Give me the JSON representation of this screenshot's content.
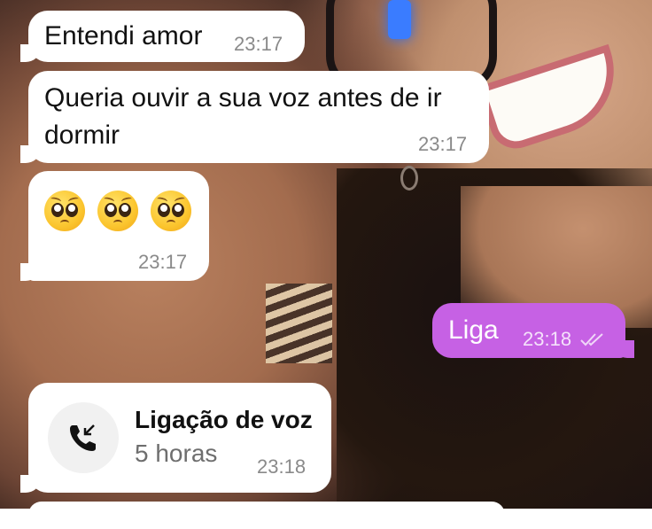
{
  "messages": [
    {
      "direction": "incoming",
      "text": "Entendi amor",
      "time": "23:17"
    },
    {
      "direction": "incoming",
      "text_line1": "Queria ouvir a sua voz antes de ir",
      "text_line2": "dormir",
      "time": "23:17"
    },
    {
      "direction": "incoming",
      "emoji": [
        "pleading-face",
        "pleading-face",
        "pleading-face"
      ],
      "time": "23:17"
    },
    {
      "direction": "outgoing",
      "text": "Liga",
      "time": "23:18",
      "status": "read"
    },
    {
      "direction": "incoming",
      "type": "call",
      "title": "Ligação de voz",
      "subtitle": "5 horas",
      "time": "23:18",
      "icon": "missed-call-icon"
    }
  ],
  "colors": {
    "incoming_bubble": "#ffffff",
    "outgoing_bubble": "#c661e4"
  }
}
